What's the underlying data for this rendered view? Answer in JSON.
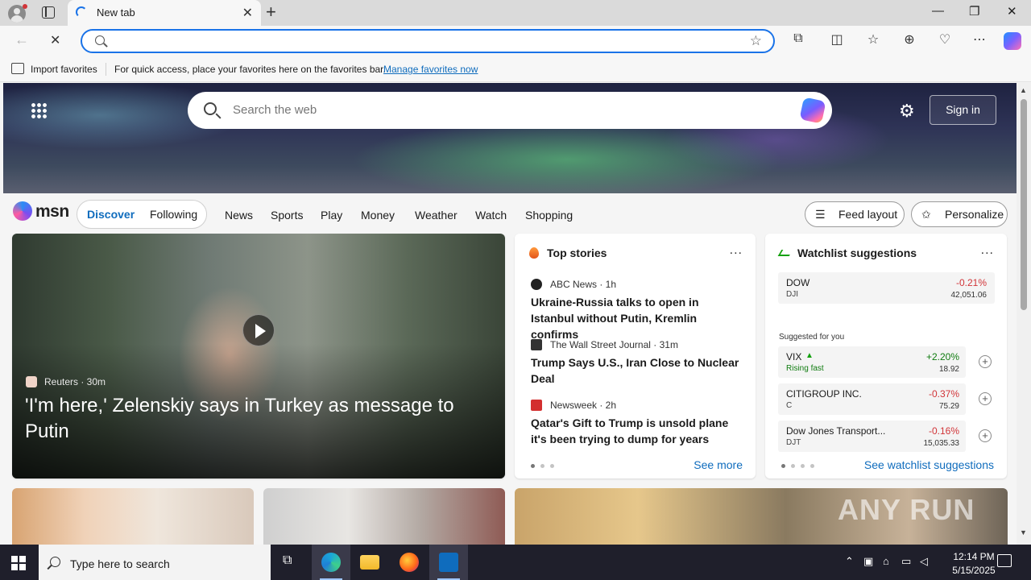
{
  "browser": {
    "tab_title": "New tab",
    "omnibox_value": "",
    "favorites_bar": {
      "import_label": "Import favorites",
      "hint_text": "For quick access, place your favorites here on the favorites bar.",
      "manage_link": "Manage favorites now"
    }
  },
  "hero": {
    "search_placeholder": "Search the web",
    "sign_in_label": "Sign in"
  },
  "msn_nav": {
    "logo_text": "msn",
    "pills": [
      "Discover",
      "Following"
    ],
    "active_pill": "Discover",
    "links": [
      "News",
      "Sports",
      "Play",
      "Money",
      "Weather",
      "Watch",
      "Shopping"
    ],
    "feed_layout_label": "Feed layout",
    "personalize_label": "Personalize"
  },
  "lead_story": {
    "source": "Reuters · 30m",
    "title": "'I'm here,' Zelenskiy says in Turkey as message to Putin"
  },
  "top_stories": {
    "title": "Top stories",
    "more": "...",
    "items": [
      {
        "source": "ABC News · 1h",
        "title": "Ukraine-Russia talks to open in Istanbul without Putin, Kremlin confirms"
      },
      {
        "source": "The Wall Street Journal · 31m",
        "title": "Trump Says U.S., Iran Close to Nuclear Deal"
      },
      {
        "source": "Newsweek · 2h",
        "title": "Qatar's Gift to Trump is unsold plane it's been trying to dump for years"
      }
    ],
    "see_more": "See more"
  },
  "watchlist": {
    "title": "Watchlist suggestions",
    "more": "...",
    "primary": {
      "name": "DOW",
      "symbol": "DJI",
      "change": "-0.21%",
      "value": "42,051.06"
    },
    "suggested_label": "Suggested for you",
    "suggestions": [
      {
        "name": "VIX",
        "symbol": "Rising fast",
        "change": "+2.20%",
        "value": "18.92"
      },
      {
        "name": "CITIGROUP INC.",
        "symbol": "C",
        "change": "-0.37%",
        "value": "75.29"
      },
      {
        "name": "Dow Jones Transport...",
        "symbol": "DJT",
        "change": "-0.16%",
        "value": "15,035.33"
      }
    ],
    "see_link": "See watchlist suggestions"
  },
  "taskbar": {
    "search_placeholder": "Type here to search",
    "time": "12:14 PM",
    "date": "5/15/2025"
  },
  "watermark": "ANY RUN",
  "colors": {
    "accent": "#0f6cbd",
    "negative": "#d13438",
    "positive": "#107c10",
    "taskbar": "#1f1f2b"
  }
}
